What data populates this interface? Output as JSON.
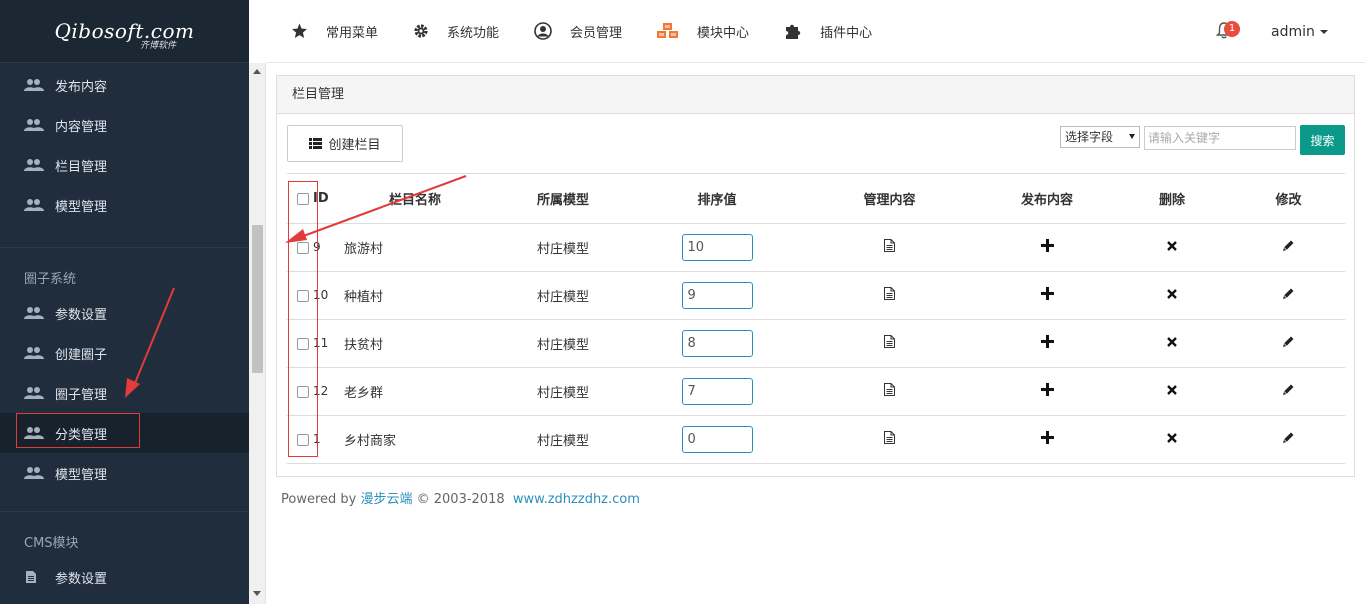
{
  "logo": {
    "main": "Qibosoft.com",
    "sub": "齐博软件"
  },
  "sidebar": {
    "items_top": [
      {
        "label": "发布内容"
      },
      {
        "label": "内容管理"
      },
      {
        "label": "栏目管理"
      },
      {
        "label": "模型管理"
      }
    ],
    "section1": "圈子系统",
    "items_mid": [
      {
        "label": "参数设置"
      },
      {
        "label": "创建圈子"
      },
      {
        "label": "圈子管理"
      },
      {
        "label": "分类管理"
      },
      {
        "label": "模型管理"
      }
    ],
    "section2": "CMS模块",
    "items_bottom": [
      {
        "label": "参数设置"
      }
    ]
  },
  "topnav": {
    "items": [
      {
        "label": "常用菜单",
        "icon": "star-icon"
      },
      {
        "label": "系统功能",
        "icon": "gear-icon"
      },
      {
        "label": "会员管理",
        "icon": "user-icon"
      },
      {
        "label": "模块中心",
        "icon": "cubes-icon"
      },
      {
        "label": "插件中心",
        "icon": "puzzle-icon"
      }
    ],
    "badge": "1",
    "user": "admin"
  },
  "panel": {
    "title": "栏目管理",
    "create_label": "创建栏目",
    "select_label": "选择字段",
    "search_placeholder": "请输入关键字",
    "search_label": "搜索"
  },
  "table": {
    "headers": [
      "ID",
      "栏目名称",
      "所属模型",
      "排序值",
      "管理内容",
      "发布内容",
      "删除",
      "修改"
    ],
    "rows": [
      {
        "id": "9",
        "name": "旅游村",
        "model": "村庄模型",
        "sort": "10"
      },
      {
        "id": "10",
        "name": "种植村",
        "model": "村庄模型",
        "sort": "9"
      },
      {
        "id": "11",
        "name": "扶贫村",
        "model": "村庄模型",
        "sort": "8"
      },
      {
        "id": "12",
        "name": "老乡群",
        "model": "村庄模型",
        "sort": "7"
      },
      {
        "id": "1",
        "name": "乡村商家",
        "model": "村庄模型",
        "sort": "0"
      }
    ]
  },
  "footer": {
    "prefix": "Powered by ",
    "brand": "漫步云端",
    "copy": " © 2003-2018  ",
    "site": "www.zdhzzdhz.com"
  },
  "colors": {
    "sidebar_bg": "#1f2d3d",
    "accent": "#0b9a8a",
    "annotation": "#e23b3b"
  }
}
